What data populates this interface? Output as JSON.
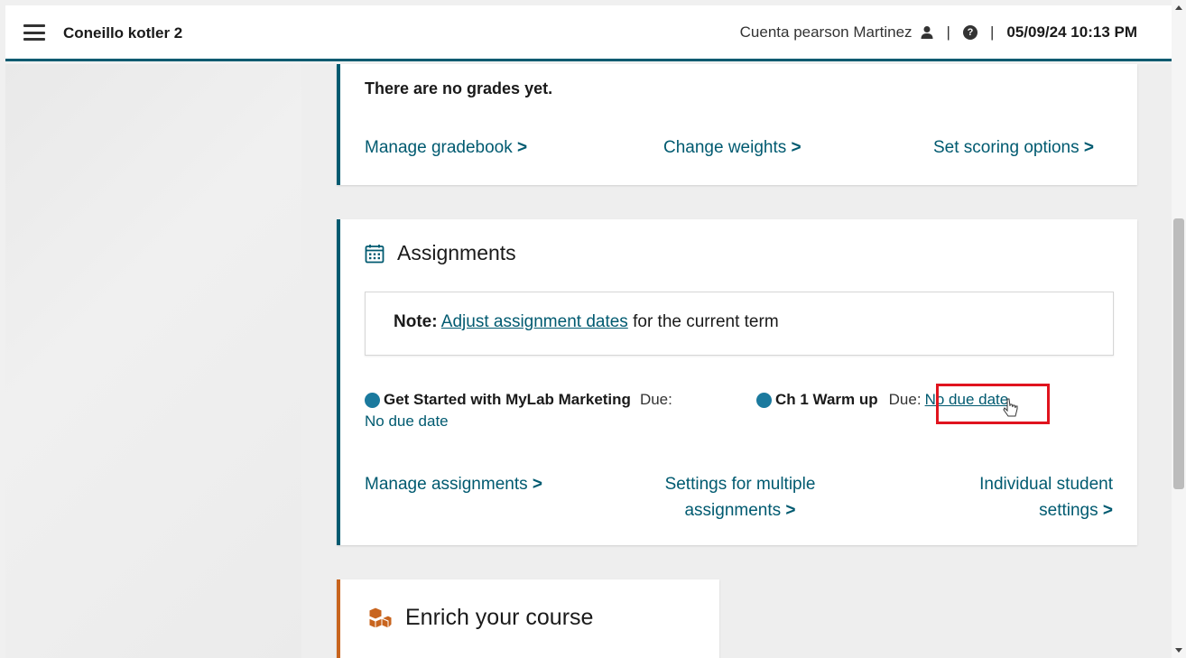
{
  "header": {
    "course_title": "Coneillo kotler 2",
    "user_name": "Cuenta pearson Martinez",
    "separator": "|",
    "datetime": "05/09/24 10:13 PM"
  },
  "grades": {
    "message": "There are no grades yet.",
    "links": {
      "manage_gradebook": "Manage gradebook",
      "change_weights": "Change weights",
      "set_scoring": "Set scoring options"
    }
  },
  "assignments": {
    "title": "Assignments",
    "note": {
      "label": "Note:",
      "link_text": "Adjust assignment dates",
      "suffix": "for the current term"
    },
    "items": [
      {
        "name": "Get Started with MyLab Marketing",
        "due_label": "Due:",
        "due_value": "No due date"
      },
      {
        "name": "Ch 1 Warm up",
        "due_label": "Due:",
        "due_value": "No due date"
      }
    ],
    "links": {
      "manage": "Manage assignments",
      "multiple_line1": "Settings for multiple",
      "multiple_line2": "assignments",
      "individual_line1": "Individual student",
      "individual_line2": "settings"
    }
  },
  "enrich": {
    "title": "Enrich your course"
  },
  "chevron": ">",
  "colors": {
    "teal": "#005a70",
    "orange": "#c8641e",
    "dot": "#1b7a9e",
    "highlight": "#e0141e"
  }
}
